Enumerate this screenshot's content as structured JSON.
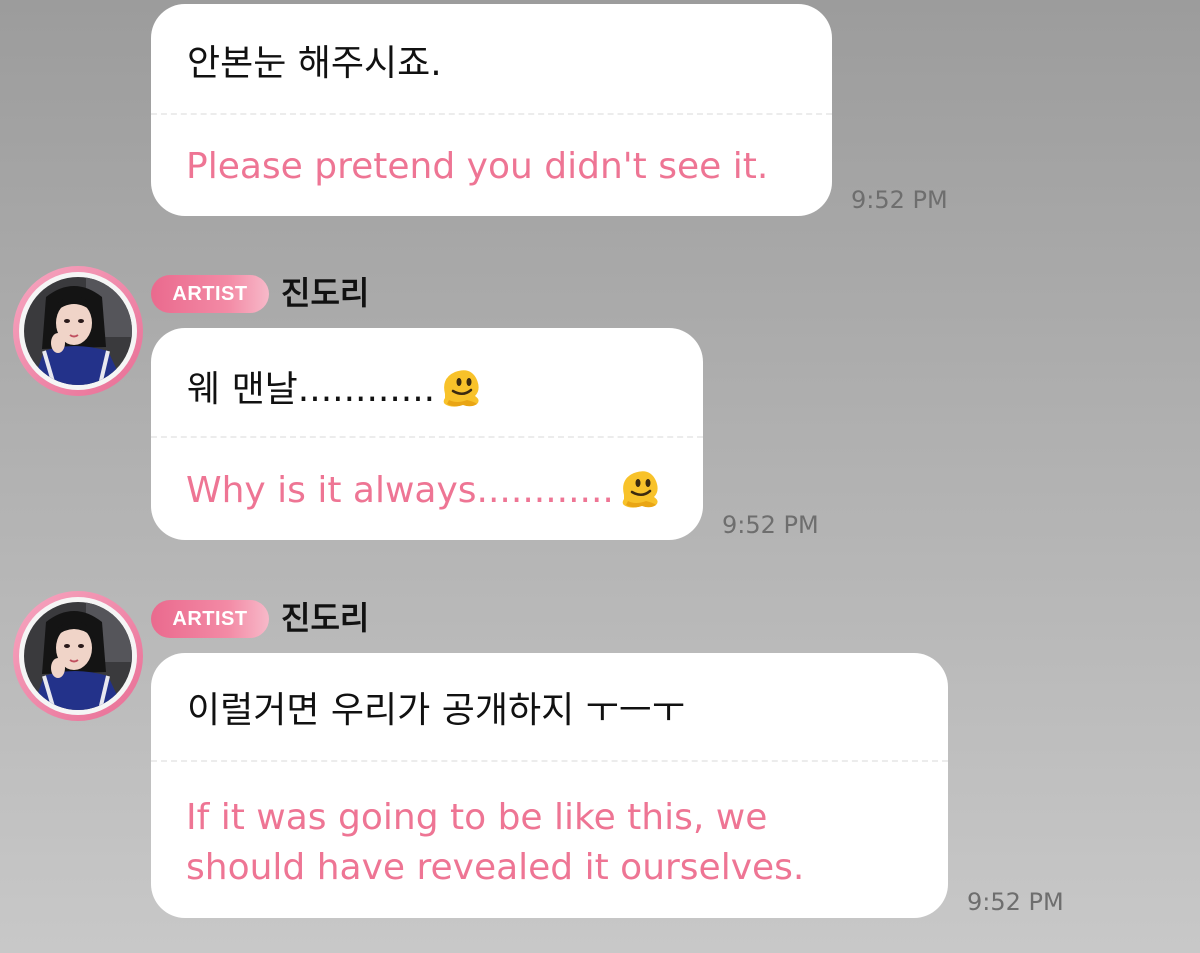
{
  "messages": [
    {
      "original": "안본눈 해주시죠.",
      "translation": "Please pretend you didn't see it.",
      "time": "9:52 PM"
    },
    {
      "badge": "ARTIST",
      "sender": "진도리",
      "original": "웨 맨날............",
      "original_emoji": "melting-face",
      "translation": "Why is it always............",
      "translation_emoji": "melting-face",
      "time": "9:52 PM"
    },
    {
      "badge": "ARTIST",
      "sender": "진도리",
      "original": "이럴거면 우리가 공개하지 ㅜㅡㅜ",
      "translation_lines": [
        "If it was going to be like this, we",
        "should have revealed it ourselves."
      ],
      "time": "9:52 PM"
    }
  ],
  "colors": {
    "translation_text": "#ee7594",
    "badge_gradient_start": "#ea6a8e",
    "avatar_ring": "#e86e95",
    "bubble": "#ffffff"
  }
}
